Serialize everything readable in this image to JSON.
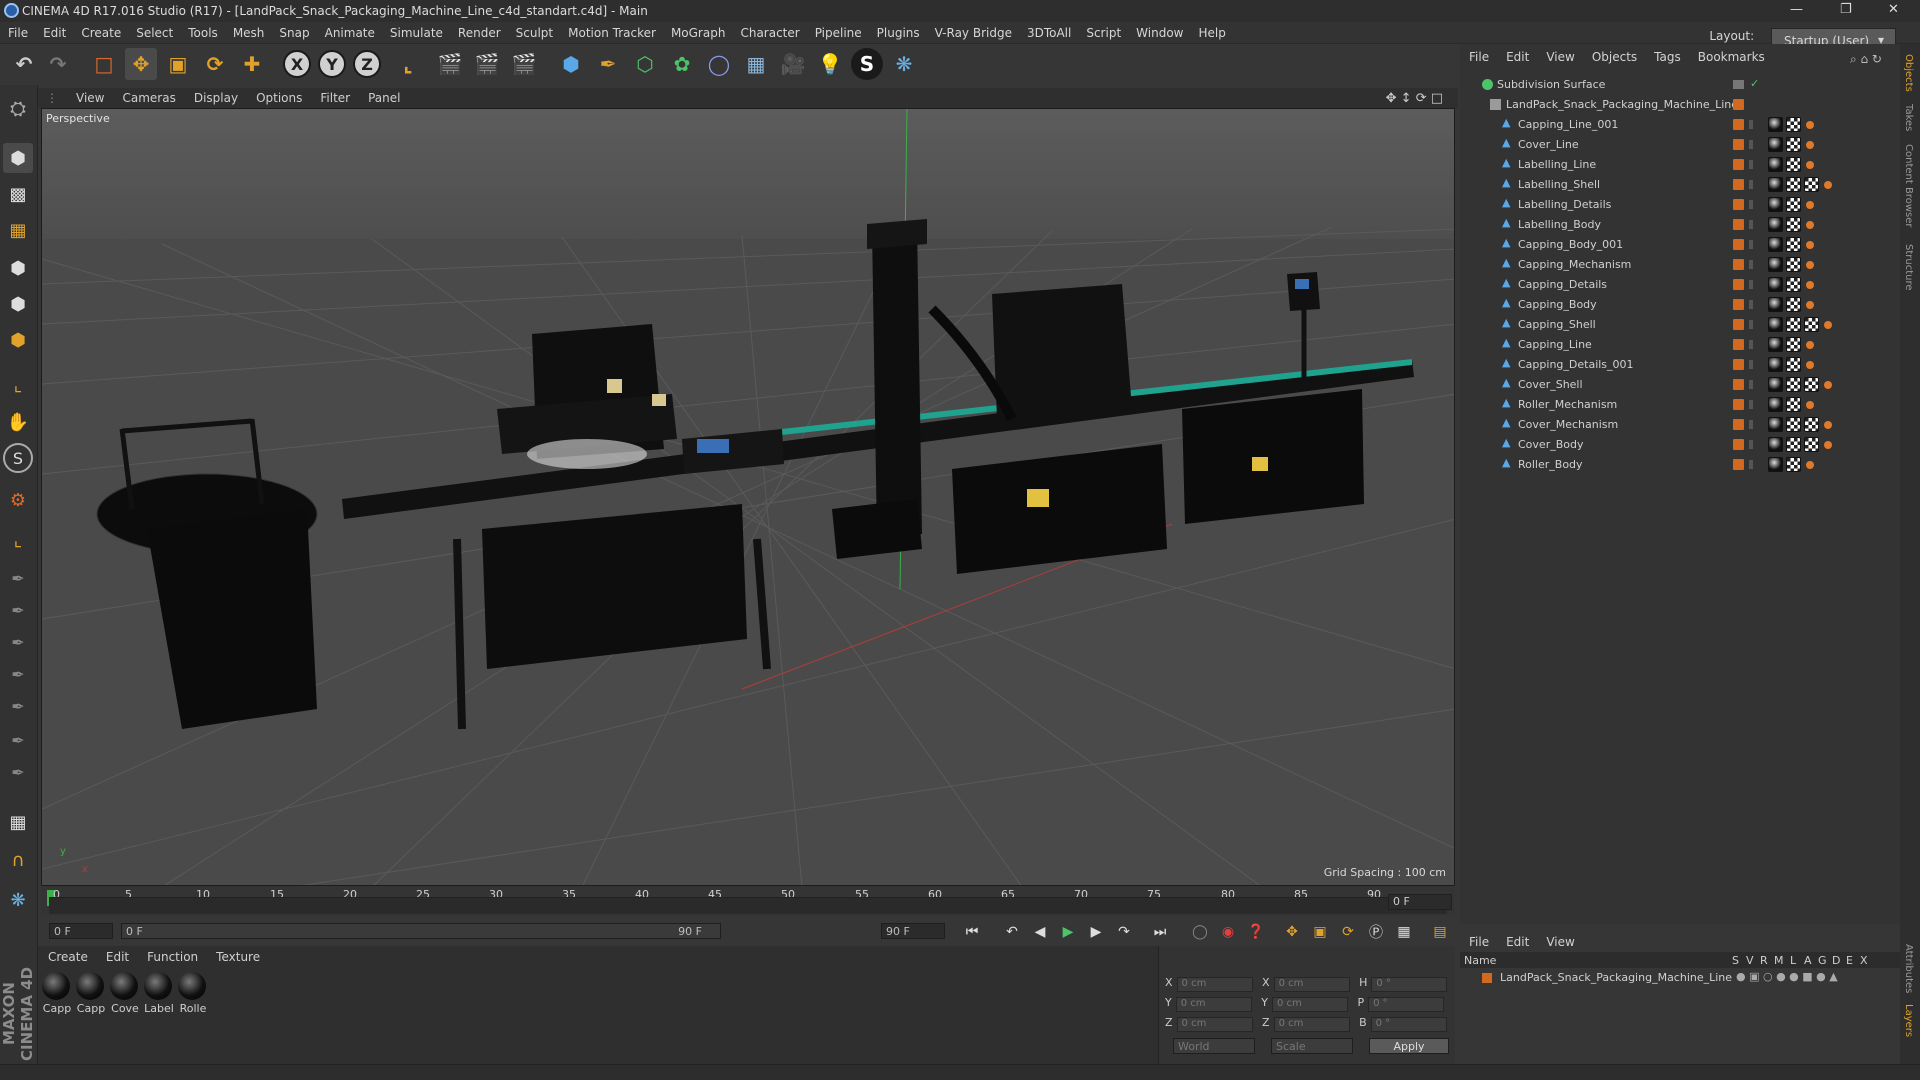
{
  "window": {
    "title": "CINEMA 4D R17.016 Studio (R17) - [LandPack_Snack_Packaging_Machine_Line_c4d_standart.c4d] - Main"
  },
  "menubar": [
    "File",
    "Edit",
    "Create",
    "Select",
    "Tools",
    "Mesh",
    "Snap",
    "Animate",
    "Simulate",
    "Render",
    "Sculpt",
    "Motion Tracker",
    "MoGraph",
    "Character",
    "Pipeline",
    "Plugins",
    "V-Ray Bridge",
    "3DToAll",
    "Script",
    "Window",
    "Help"
  ],
  "layout": {
    "label": "Layout:",
    "value": "Startup (User)"
  },
  "viewport": {
    "menu": [
      "View",
      "Cameras",
      "Display",
      "Options",
      "Filter",
      "Panel"
    ],
    "camera_label": "Perspective",
    "grid_spacing": "Grid Spacing : 100 cm"
  },
  "timeline": {
    "ticks": [
      "0",
      "5",
      "10",
      "15",
      "20",
      "25",
      "30",
      "35",
      "40",
      "45",
      "50",
      "55",
      "60",
      "65",
      "70",
      "75",
      "80",
      "85",
      "90"
    ],
    "current_frame": "0 F",
    "end_frame_display": "0 F"
  },
  "transport": {
    "start_field": "0 F",
    "range_start": "0 F",
    "range_end": "90 F",
    "end_field": "90 F"
  },
  "material_manager": {
    "menu": [
      "Create",
      "Edit",
      "Function",
      "Texture"
    ],
    "materials": [
      "Capp",
      "Capp",
      "Cove",
      "Label",
      "Rolle"
    ]
  },
  "coordinates": {
    "rows": [
      {
        "a": "X",
        "av": "0 cm",
        "b": "X",
        "bv": "0 cm",
        "c": "H",
        "cv": "0 °"
      },
      {
        "a": "Y",
        "av": "0 cm",
        "b": "Y",
        "bv": "0 cm",
        "c": "P",
        "cv": "0 °"
      },
      {
        "a": "Z",
        "av": "0 cm",
        "b": "Z",
        "bv": "0 cm",
        "c": "B",
        "cv": "0 °"
      }
    ],
    "mode": "World",
    "scale": "Scale",
    "apply": "Apply"
  },
  "object_manager": {
    "menu": [
      "File",
      "Edit",
      "View",
      "Objects",
      "Tags",
      "Bookmarks"
    ],
    "root": "Subdivision Surface",
    "parent": "LandPack_Snack_Packaging_Machine_Line",
    "objects": [
      "Capping_Line_001",
      "Cover_Line",
      "Labelling_Line",
      "Labelling_Shell",
      "Labelling_Details",
      "Labelling_Body",
      "Capping_Body_001",
      "Capping_Mechanism",
      "Capping_Details",
      "Capping_Body",
      "Capping_Shell",
      "Capping_Line",
      "Capping_Details_001",
      "Cover_Shell",
      "Roller_Mechanism",
      "Cover_Mechanism",
      "Cover_Body",
      "Roller_Body"
    ]
  },
  "layer_manager": {
    "menu": [
      "File",
      "Edit",
      "View"
    ],
    "columns": [
      "Name",
      "S",
      "V",
      "R",
      "M",
      "L",
      "A",
      "G",
      "D",
      "E",
      "X"
    ],
    "layer": "LandPack_Snack_Packaging_Machine_Line"
  },
  "right_tabs": [
    "Objects",
    "Takes",
    "Content Browser",
    "Structure",
    "Attributes",
    "Layers"
  ],
  "brand": "MAXON CINEMA 4D"
}
